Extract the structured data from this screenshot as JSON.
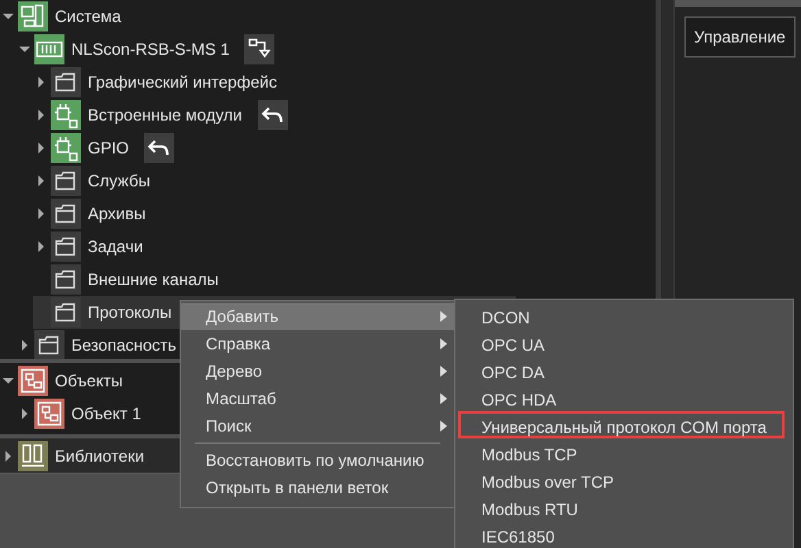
{
  "tree": [
    {
      "label": "Система",
      "kind": "system",
      "expandable": true,
      "expanded": true,
      "selected": false,
      "children": [
        {
          "label": "NLScon-RSB-S-MS 1",
          "kind": "device",
          "expandable": true,
          "expanded": true,
          "selected": false,
          "action": {
            "kind": "export"
          },
          "children": [
            {
              "label": "Графический интерфейс",
              "kind": "folder",
              "expandable": true,
              "expanded": false,
              "selected": false
            },
            {
              "label": "Встроенные модули",
              "kind": "module",
              "expandable": true,
              "expanded": false,
              "selected": false,
              "action": {
                "kind": "undo"
              }
            },
            {
              "label": "GPIO",
              "kind": "module",
              "expandable": true,
              "expanded": false,
              "selected": false,
              "action": {
                "kind": "undo"
              }
            },
            {
              "label": "Службы",
              "kind": "folder",
              "expandable": true,
              "expanded": false,
              "selected": false
            },
            {
              "label": "Архивы",
              "kind": "folder",
              "expandable": true,
              "expanded": false,
              "selected": false
            },
            {
              "label": "Задачи",
              "kind": "folder",
              "expandable": true,
              "expanded": false,
              "selected": false
            },
            {
              "label": "Внешние каналы",
              "kind": "folder",
              "expandable": false,
              "selected": false
            },
            {
              "label": "Протоколы",
              "kind": "folder",
              "expandable": false,
              "selected": true
            }
          ]
        },
        {
          "label": "Безопасность",
          "kind": "folder",
          "expandable": true,
          "expanded": false,
          "selected": false
        }
      ]
    }
  ],
  "objects": [
    {
      "label": "Объекты",
      "kind": "objects",
      "expandable": true,
      "expanded": true,
      "selected": false,
      "children": [
        {
          "label": "Объект 1",
          "kind": "object",
          "expandable": true,
          "expanded": false,
          "selected": false
        }
      ]
    }
  ],
  "libraries": [
    {
      "label": "Библиотеки",
      "kind": "library",
      "expandable": true,
      "expanded": false,
      "selected": false
    }
  ],
  "right_panel": {
    "tabs": [
      {
        "label": "Управление",
        "selected": true
      }
    ]
  },
  "context_menu": [
    {
      "kind": "item",
      "label": "Добавить",
      "submenu": true,
      "selected": true
    },
    {
      "kind": "item",
      "label": "Справка",
      "submenu": true,
      "selected": false
    },
    {
      "kind": "item",
      "label": "Дерево",
      "submenu": true,
      "selected": false
    },
    {
      "kind": "item",
      "label": "Масштаб",
      "submenu": true,
      "selected": false
    },
    {
      "kind": "item",
      "label": "Поиск",
      "submenu": true,
      "selected": false
    },
    {
      "kind": "separator"
    },
    {
      "kind": "item",
      "label": "Восстановить по умолчанию",
      "submenu": false,
      "selected": false
    },
    {
      "kind": "item",
      "label": "Открыть в панели веток",
      "submenu": false,
      "selected": false
    }
  ],
  "submenu": [
    {
      "label": "DCON",
      "highlighted": false
    },
    {
      "label": "OPC UA",
      "highlighted": false
    },
    {
      "label": "OPC DA",
      "highlighted": false
    },
    {
      "label": "OPC HDA",
      "highlighted": false
    },
    {
      "label": "Универсальный протокол COM порта",
      "highlighted": true
    },
    {
      "label": "Modbus TCP",
      "highlighted": false
    },
    {
      "label": "Modbus over TCP",
      "highlighted": false
    },
    {
      "label": "Modbus RTU",
      "highlighted": false
    },
    {
      "label": "IEC61850",
      "highlighted": false
    }
  ]
}
